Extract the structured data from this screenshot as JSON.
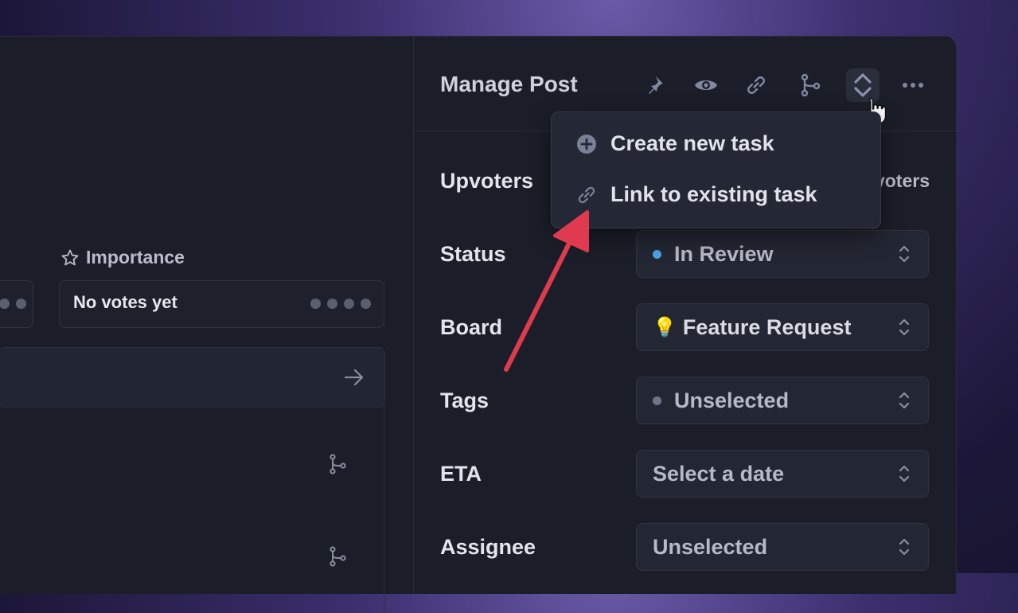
{
  "left": {
    "importance_label": "Importance",
    "votes_text": "No votes yet"
  },
  "header": {
    "title": "Manage Post"
  },
  "toolbar_icons": [
    "pin-icon",
    "eye-icon",
    "link-icon",
    "branch-icon",
    "task-icon",
    "more-icon"
  ],
  "dropdown": {
    "items": [
      {
        "label": "Create new task",
        "icon": "plus-circle-icon"
      },
      {
        "label": "Link to existing task",
        "icon": "link-icon"
      }
    ]
  },
  "fields": {
    "upvoters_label": "Upvoters",
    "upvoters_value": "voters",
    "status_label": "Status",
    "status_value": "In Review",
    "status_color": "#4aa3e0",
    "board_label": "Board",
    "board_emoji": "💡",
    "board_value": "Feature Request",
    "tags_label": "Tags",
    "tags_value": "Unselected",
    "eta_label": "ETA",
    "eta_value": "Select a date",
    "assignee_label": "Assignee",
    "assignee_value": "Unselected"
  },
  "colors": {
    "accent_arrow": "#e03a50",
    "panel_bg": "#1b1e28"
  }
}
